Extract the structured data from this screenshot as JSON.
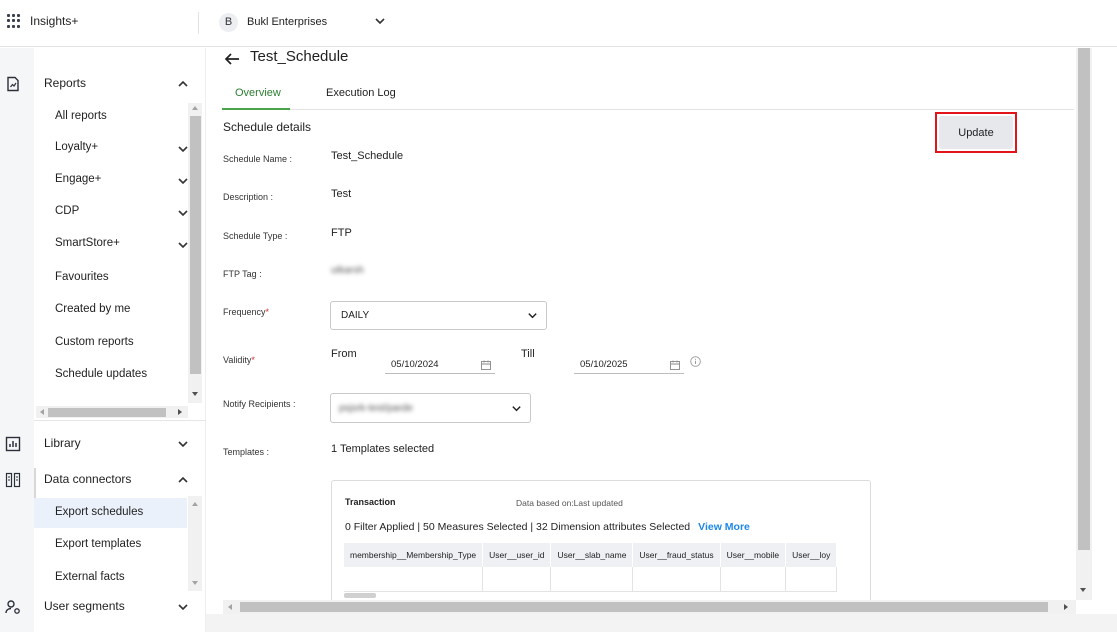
{
  "app": {
    "title": "Insights+"
  },
  "org": {
    "avatar": "B",
    "name": "Bukl Enterprises"
  },
  "nav": {
    "reports": "Reports",
    "items": [
      "All reports",
      "Loyalty+",
      "Engage+",
      "CDP",
      "SmartStore+",
      "Favourites",
      "Created by me",
      "Custom reports",
      "Schedule updates"
    ],
    "library": "Library",
    "data_connectors": "Data connectors",
    "dc_items": [
      "Export schedules",
      "Export templates",
      "External facts"
    ],
    "user_segments": "User segments"
  },
  "page": {
    "title": "Test_Schedule",
    "tabs": [
      "Overview",
      "Execution Log"
    ],
    "section_title": "Schedule details",
    "update_label": "Update"
  },
  "fields": {
    "schedule_name_label": "Schedule Name",
    "schedule_name": "Test_Schedule",
    "description_label": "Description",
    "description": "Test",
    "schedule_type_label": "Schedule Type",
    "schedule_type": "FTP",
    "ftp_tag_label": "FTP Tag",
    "ftp_tag": "utkarsh",
    "frequency_label": "Frequency",
    "frequency": "DAILY",
    "validity_label": "Validity",
    "from_label": "From",
    "from_date": "05/10/2024",
    "till_label": "Till",
    "till_date": "05/10/2025",
    "notify_label": "Notify Recipients",
    "notify_value": "psjsrk-test/parde",
    "templates_label": "Templates",
    "templates_value": "1 Templates selected"
  },
  "template_card": {
    "title": "Transaction",
    "based_on": "Data based on:Last updated",
    "summary": "0 Filter Applied | 50 Measures Selected | 32 Dimension attributes Selected",
    "view_more": "View More",
    "columns": [
      "membership__Membership_Type",
      "User__user_id",
      "User__slab_name",
      "User__fraud_status",
      "User__mobile",
      "User__loy"
    ]
  }
}
